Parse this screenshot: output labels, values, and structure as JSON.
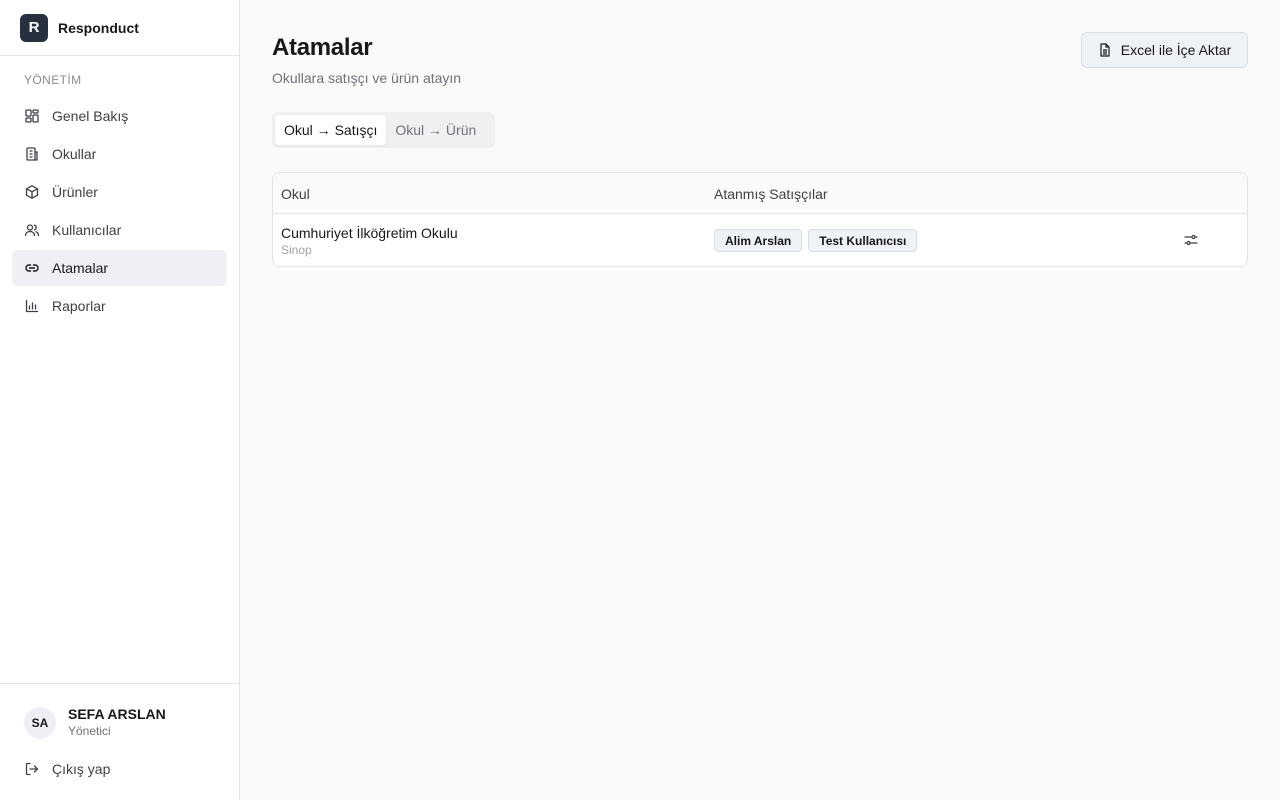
{
  "brand": {
    "logo_letter": "R",
    "name": "Responduct"
  },
  "sidebar": {
    "section_label": "YÖNETİM",
    "items": [
      {
        "label": "Genel Bakış",
        "icon": "dashboard-icon"
      },
      {
        "label": "Okullar",
        "icon": "building-icon"
      },
      {
        "label": "Ürünler",
        "icon": "package-icon"
      },
      {
        "label": "Kullanıcılar",
        "icon": "users-icon"
      },
      {
        "label": "Atamalar",
        "icon": "link-icon",
        "active": true
      },
      {
        "label": "Raporlar",
        "icon": "bar-chart-icon"
      }
    ]
  },
  "user": {
    "initials": "SA",
    "name": "SEFA ARSLAN",
    "role": "Yönetici"
  },
  "logout": {
    "label": "Çıkış yap",
    "icon": "logout-icon"
  },
  "page": {
    "title": "Atamalar",
    "subtitle": "Okullara satışçı ve ürün atayın",
    "import_button": {
      "label": "Excel ile İçe Aktar",
      "icon": "file-spreadsheet-icon"
    }
  },
  "tabs": [
    {
      "label": "Okul → Satışçı",
      "active": true
    },
    {
      "label": "Okul → Ürün",
      "active": false
    }
  ],
  "table": {
    "columns": [
      "Okul",
      "Atanmış Satışçılar"
    ],
    "rows": [
      {
        "school": "Cumhuriyet İlköğretim Okulu",
        "city": "Sinop",
        "salespeople": [
          "Alim Arslan",
          "Test Kullanıcısı"
        ],
        "action_icon": "sliders-icon"
      }
    ]
  },
  "colors": {
    "brand": "#27303f",
    "active_nav_bg": "#eef0f4",
    "badge_bg": "#eef1f5"
  }
}
